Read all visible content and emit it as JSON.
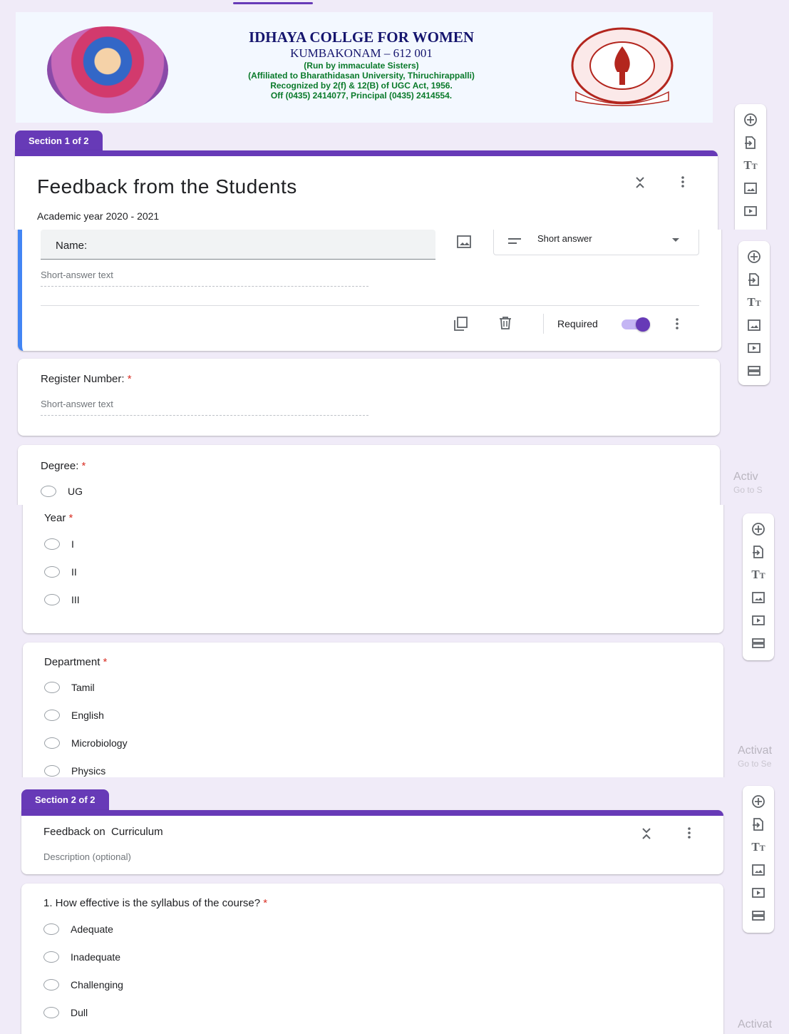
{
  "header": {
    "college_name": "IDHAYA COLLGE FOR WOMEN",
    "city": "KUMBAKONAM – 612 001",
    "run_by": "(Run by immaculate Sisters)",
    "affiliation": "(Affiliated to Bharathidasan University, Thiruchirappalli)",
    "recognition": "Recognized by 2(f) & 12(B) of UGC Act, 1956.",
    "phones": "Off (0435) 2414077, Principal (0435) 2414554.",
    "seal_text": "IDHAYA COLLEGE FOR WOMEN",
    "seal_motto": "STRIVE · KUMBAKONAM · SHINE"
  },
  "section1": {
    "tab": "Section 1 of 2",
    "title": "Feedback from the Students",
    "description": "Academic year 2020 - 2021"
  },
  "name_question": {
    "label": "Name:",
    "placeholder": "Short-answer text",
    "type_selected": "Short answer",
    "required_label": "Required",
    "required_on": true
  },
  "register_question": {
    "label": "Register Number:",
    "required_mark": "*",
    "placeholder": "Short-answer text"
  },
  "degree_question": {
    "label": "Degree:",
    "required_mark": "*",
    "options": [
      "UG"
    ]
  },
  "year_question": {
    "label": "Year",
    "required_mark": "*",
    "options": [
      "I",
      "II",
      "III"
    ]
  },
  "department_question": {
    "label": "Department",
    "required_mark": "*",
    "options": [
      "Tamil",
      "English",
      "Microbiology",
      "Physics"
    ]
  },
  "section2": {
    "tab": "Section 2 of 2",
    "title": "Feedback on  Curriculum",
    "description": "Description (optional)"
  },
  "syllabus_question": {
    "label": "1. How effective is the syllabus of the course?",
    "required_mark": "*",
    "options": [
      "Adequate",
      "Inadequate",
      "Challenging",
      "Dull"
    ]
  },
  "watermarks": {
    "w1_title": "Activ",
    "w1_sub": "Go to S",
    "w2_title": "Activat",
    "w2_sub": "Go to Se",
    "w3_title": "Activat"
  },
  "colors": {
    "accent": "#673ab7",
    "focus_bar": "#4285f4",
    "background": "#f0ebf8",
    "required": "#d93025"
  },
  "toolbar_icons": [
    "add-question-icon",
    "import-questions-icon",
    "add-title-icon",
    "add-image-icon",
    "add-video-icon",
    "add-section-icon"
  ]
}
